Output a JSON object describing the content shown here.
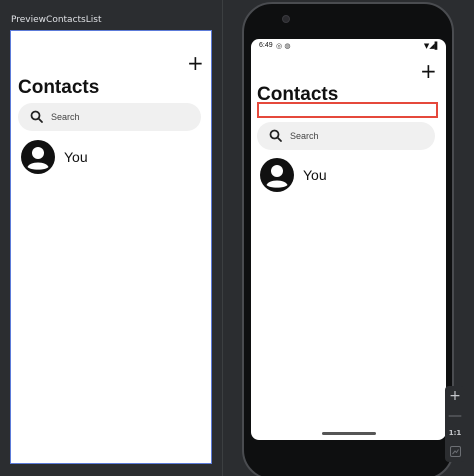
{
  "preview": {
    "label": "PreviewContactsList"
  },
  "app": {
    "add_icon": "+",
    "title": "Contacts",
    "search_placeholder": "Search",
    "contacts": [
      {
        "name": "You"
      }
    ]
  },
  "device": {
    "status_time": "6:49",
    "status_left_icons": "◎ ◍",
    "status_right_icons": "▼◢▌"
  },
  "zoom": {
    "plus": "+",
    "minus": "—",
    "ratio": "1:1"
  },
  "colors": {
    "accent_border": "#5c7bd9",
    "highlight": "#e5483b",
    "search_bg": "#f0f0f0",
    "ide_bg": "#2b2d30"
  }
}
